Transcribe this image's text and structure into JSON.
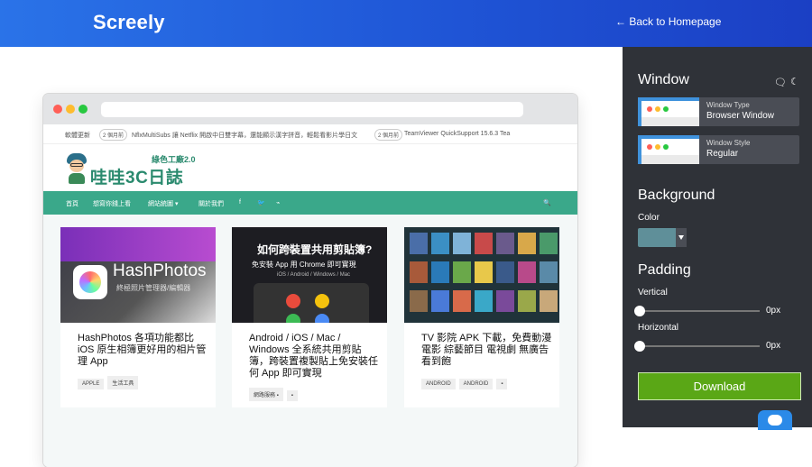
{
  "app": {
    "brand": "Screely",
    "back_link": "← Back to Homepage"
  },
  "preview": {
    "ticker": {
      "label": "軟體更新",
      "items": [
        {
          "badge": "2 個月前",
          "text": "NflxMultiSubs 讓 Netflix 開啟中日雙字幕，還能顯示漢字拼音，輕鬆看影片學日文"
        },
        {
          "badge": "2 個月前",
          "text": "TeamViewer QuickSupport 15.6.3 Tea"
        }
      ]
    },
    "site": {
      "name": "哇哇3C日誌",
      "tagline": "綠色工廠2.0"
    },
    "nav": [
      "首頁",
      "想寫你錢上看",
      "網站統圖 ▾",
      "關於我們",
      "f",
      "🐦",
      "⌁",
      "🔍"
    ],
    "cards": [
      {
        "thumb_title": "HashPhotos",
        "thumb_sub": "終極照片管理器/編輯器",
        "title": "HashPhotos 各項功能都比 iOS 原生相簿更好用的相片管理 App",
        "tags": [
          "APPLE",
          "生活工具"
        ]
      },
      {
        "thumb_title": "如何跨裝置共用剪貼簿?",
        "thumb_sub": "免安裝 App 用 Chrome 即可實現",
        "thumb_small": "iOS / Android / Windows / Mac",
        "title": "Android / iOS / Mac / Windows 全系統共用剪貼簿，跨裝置複製貼上免安裝任何 App 即可實現",
        "tags": [
          "網路服務 ▪",
          "▪"
        ]
      },
      {
        "title": "TV 影院 APK 下載，免費動漫 電影 綜藝節目 電視劇 無廣告看到飽",
        "tags": [
          "ANDROID",
          "ANDROID",
          "▪"
        ]
      }
    ]
  },
  "panel": {
    "window": {
      "heading": "Window",
      "tools": [
        "speech-bubble-icon",
        "moon-icon"
      ],
      "window_type": {
        "label": "Window Type",
        "value": "Browser Window"
      },
      "window_style": {
        "label": "Window Style",
        "value": "Regular"
      }
    },
    "background": {
      "heading": "Background",
      "color_label": "Color",
      "color_value": "#5f8f99"
    },
    "padding": {
      "heading": "Padding",
      "vertical_label": "Vertical",
      "vertical_value": "0px",
      "horizontal_label": "Horizontal",
      "horizontal_value": "0px"
    },
    "download_label": "Download"
  },
  "colors": {
    "header_gradient": [
      "#2a73e8",
      "#1b3fc4"
    ],
    "panel_bg": "#2f3238",
    "accent_download": "#5aa716",
    "site_green": "#3aa88a"
  }
}
